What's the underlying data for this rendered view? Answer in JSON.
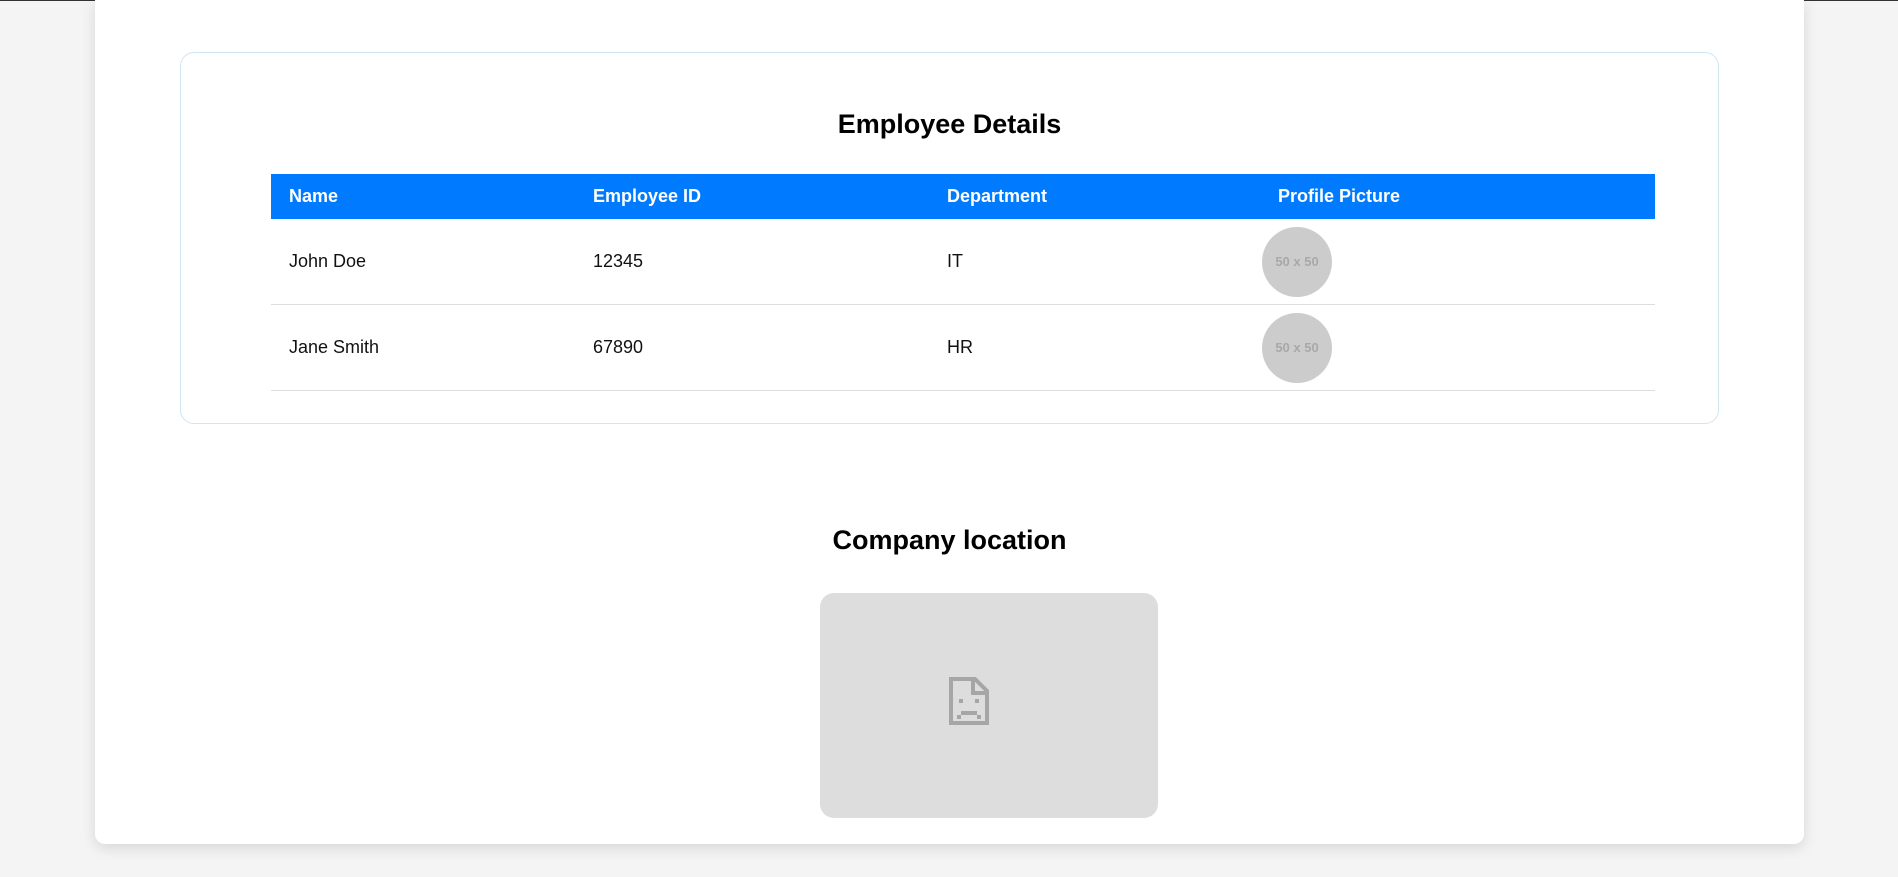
{
  "employees_section": {
    "title": "Employee Details",
    "columns": [
      "Name",
      "Employee ID",
      "Department",
      "Profile Picture"
    ],
    "rows": [
      {
        "name": "John Doe",
        "id": "12345",
        "department": "IT",
        "avatar_text": "50 x 50"
      },
      {
        "name": "Jane Smith",
        "id": "67890",
        "department": "HR",
        "avatar_text": "50 x 50"
      }
    ]
  },
  "location_section": {
    "title": "Company location",
    "map_icon": "broken-image-icon"
  },
  "colors": {
    "header_accent": "#007bff",
    "avatar_placeholder": "#cccccc",
    "map_placeholder": "#dddddd"
  }
}
